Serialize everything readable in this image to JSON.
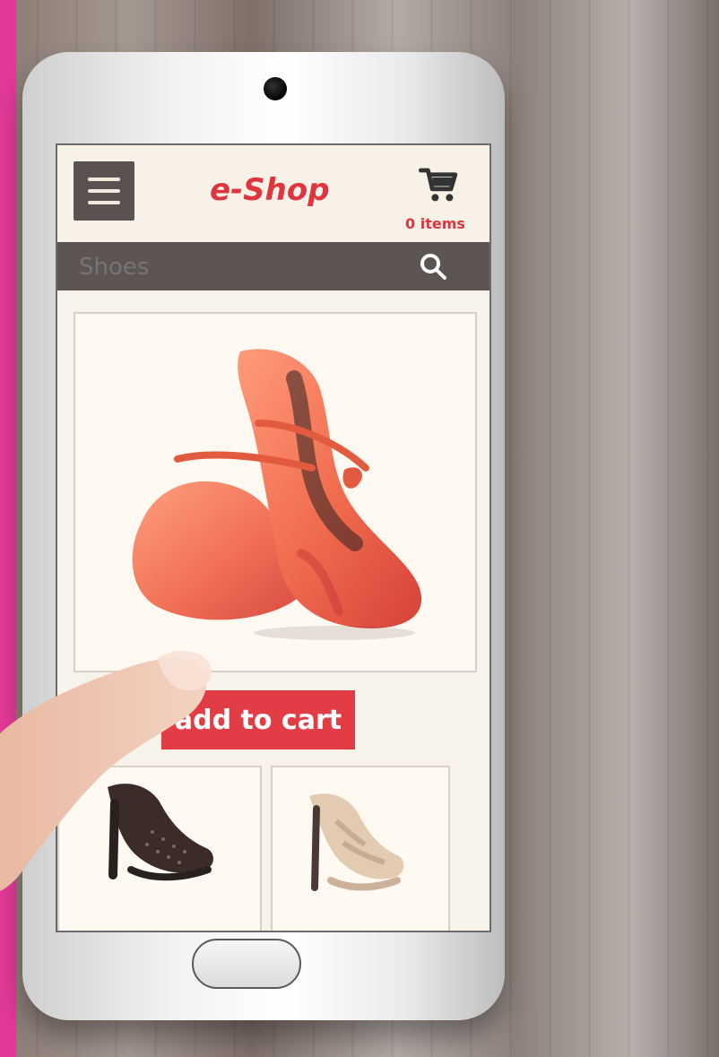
{
  "colors": {
    "accent": "#e0353f",
    "button": "#e23d45",
    "header_dark": "#5c5554",
    "menu_dark": "#5a5250",
    "screen_bg": "#f3ede4",
    "pink_edge": "#e3399a"
  },
  "header": {
    "title": "e-Shop",
    "cart_count": "0 items"
  },
  "search": {
    "placeholder": "Shoes"
  },
  "product": {
    "add_to_cart_label": "add to cart"
  },
  "icons": {
    "menu": "menu-icon",
    "cart": "cart-icon",
    "search": "search-icon",
    "home": "home-button-icon"
  }
}
